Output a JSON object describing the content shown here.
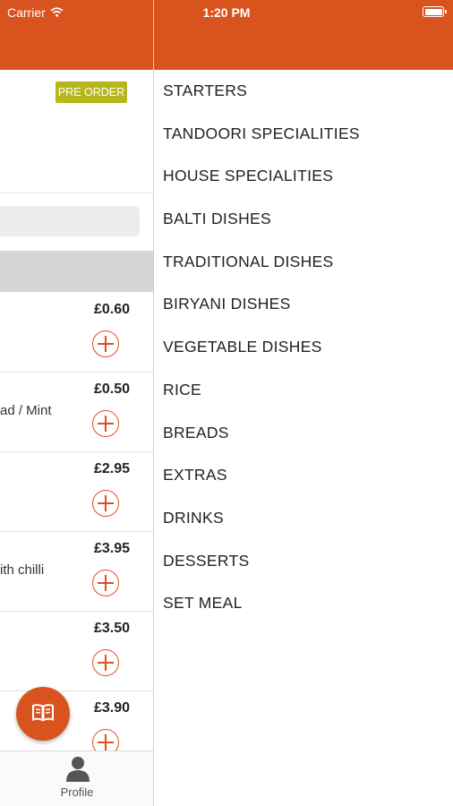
{
  "status_bar": {
    "carrier": "Carrier",
    "time": "1:20 PM"
  },
  "main": {
    "badge": "PRE ORDER",
    "items": [
      {
        "price": "£0.60",
        "desc": ""
      },
      {
        "price": "£0.50",
        "desc": "ad / Mint"
      },
      {
        "price": "£2.95",
        "desc": ""
      },
      {
        "price": "£3.95",
        "desc": "ith chilli"
      },
      {
        "price": "£3.50",
        "desc": ""
      },
      {
        "price": "£3.90",
        "desc": ""
      }
    ]
  },
  "tab_bar": {
    "profile_label": "Profile"
  },
  "drawer": {
    "categories": [
      "STARTERS",
      "TANDOORI SPECIALITIES",
      "HOUSE SPECIALITIES",
      "BALTI DISHES",
      "TRADITIONAL DISHES",
      "BIRYANI DISHES",
      "VEGETABLE DISHES",
      "RICE",
      "BREADS",
      "EXTRAS",
      "DRINKS",
      "DESSERTS",
      "SET MEAL"
    ]
  },
  "colors": {
    "accent": "#d9531e",
    "badge": "#b7b71c"
  },
  "icons": {
    "wifi": "wifi-icon",
    "battery": "battery-icon",
    "menu_book": "menu-book-icon",
    "profile": "profile-icon",
    "add": "add-circle-icon"
  }
}
